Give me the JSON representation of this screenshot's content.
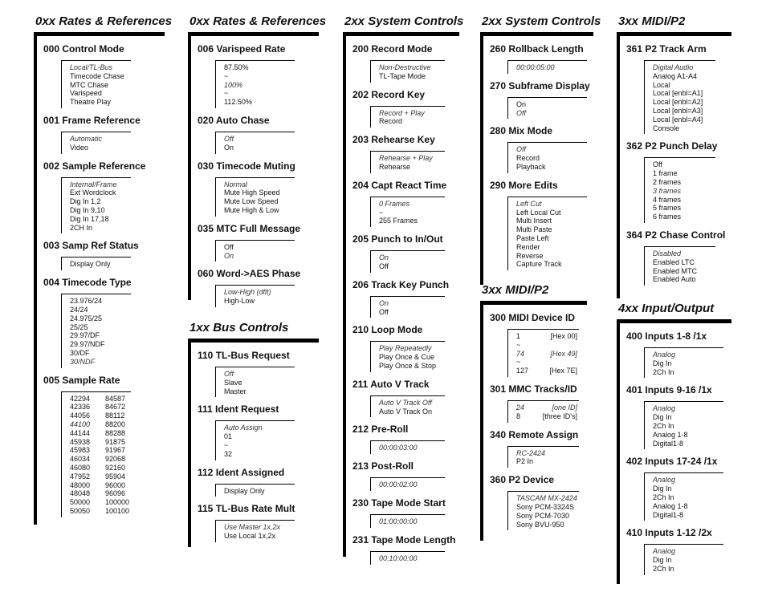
{
  "sections": [
    {
      "heading": "0xx Rates & References",
      "items": [
        {
          "title": "000 Control Mode",
          "options": [
            {
              "text": "Local/TL-Bus",
              "default": true
            },
            {
              "text": "Timecode Chase"
            },
            {
              "text": "MTC Chase"
            },
            {
              "text": "Varispeed"
            },
            {
              "text": "Theatre Play"
            }
          ]
        },
        {
          "title": "001 Frame Reference",
          "options": [
            {
              "text": "Automatic",
              "default": true
            },
            {
              "text": "Video"
            }
          ]
        },
        {
          "title": "002 Sample Reference",
          "options": [
            {
              "text": "Internal/Frame",
              "default": true
            },
            {
              "text": "Ext Wordclock"
            },
            {
              "text": "Dig In 1,2"
            },
            {
              "text": "Dig In 9,10"
            },
            {
              "text": "Dig In 17,18"
            },
            {
              "text": "2CH In"
            }
          ]
        },
        {
          "title": "003 Samp Ref Status",
          "options": [
            {
              "text": "Display Only"
            }
          ]
        },
        {
          "title": "004 Timecode Type",
          "options": [
            {
              "text": "23.976/24"
            },
            {
              "text": "24/24"
            },
            {
              "text": "24.975/25"
            },
            {
              "text": "25/25"
            },
            {
              "text": "29.97/DF"
            },
            {
              "text": "29.97/NDF"
            },
            {
              "text": "30/DF"
            },
            {
              "text": "30/NDF",
              "default": true
            }
          ]
        },
        {
          "title": "005 Sample Rate",
          "options": [
            {
              "text": "42294",
              "text2": "84587"
            },
            {
              "text": "42336",
              "text2": "84672"
            },
            {
              "text": "44056",
              "text2": "88112"
            },
            {
              "text": "44100",
              "text2": "88200",
              "default": true
            },
            {
              "text": "44144",
              "text2": "88288"
            },
            {
              "text": "45938",
              "text2": "91875"
            },
            {
              "text": "45983",
              "text2": "91967"
            },
            {
              "text": "46034",
              "text2": "92068"
            },
            {
              "text": "46080",
              "text2": "92160"
            },
            {
              "text": "47952",
              "text2": "95904"
            },
            {
              "text": "48000",
              "text2": "96000"
            },
            {
              "text": "48048",
              "text2": "96096"
            },
            {
              "text": "50000",
              "text2": "100000"
            },
            {
              "text": "50050",
              "text2": "100100"
            }
          ]
        }
      ]
    },
    {
      "heading": "0xx Rates & References",
      "items": [
        {
          "title": "006 Varispeed Rate",
          "options": [
            {
              "text": "87.50%"
            },
            {
              "text": "~"
            },
            {
              "text": "100%",
              "default": true
            },
            {
              "text": "~"
            },
            {
              "text": "112.50%"
            }
          ]
        },
        {
          "title": "020 Auto Chase",
          "options": [
            {
              "text": "Off",
              "default": true
            },
            {
              "text": "On"
            }
          ]
        },
        {
          "title": "030 Timecode Muting",
          "options": [
            {
              "text": "Normal",
              "default": true
            },
            {
              "text": "Mute High Speed"
            },
            {
              "text": "Mute Low Speed"
            },
            {
              "text": "Mute High & Low"
            }
          ]
        },
        {
          "title": "035 MTC Full Message",
          "options": [
            {
              "text": "Off"
            },
            {
              "text": "On",
              "default": true
            }
          ]
        },
        {
          "title": "060 Word->AES Phase",
          "options": [
            {
              "text": "Low-High (dflt)",
              "default": true
            },
            {
              "text": "High-Low"
            }
          ]
        }
      ]
    },
    {
      "heading": "1xx Bus Controls",
      "items": [
        {
          "title": "110 TL-Bus Request",
          "options": [
            {
              "text": "Off",
              "default": true
            },
            {
              "text": "Slave"
            },
            {
              "text": "Master"
            }
          ]
        },
        {
          "title": "111 Ident Request",
          "options": [
            {
              "text": "Auto Assign",
              "default": true
            },
            {
              "text": "01"
            },
            {
              "text": "~"
            },
            {
              "text": "32"
            }
          ]
        },
        {
          "title": "112 Ident Assigned",
          "options": [
            {
              "text": "Display Only"
            }
          ]
        },
        {
          "title": "115 TL-Bus Rate Mult",
          "options": [
            {
              "text": "Use Master 1x,2x",
              "default": true
            },
            {
              "text": "Use Local 1x,2x"
            }
          ]
        }
      ]
    },
    {
      "heading": "2xx System Controls",
      "items": [
        {
          "title": "200 Record Mode",
          "options": [
            {
              "text": "Non-Destructive",
              "default": true
            },
            {
              "text": "TL-Tape Mode"
            }
          ]
        },
        {
          "title": "202 Record Key",
          "options": [
            {
              "text": "Record + Play",
              "default": true
            },
            {
              "text": "Record"
            }
          ]
        },
        {
          "title": "203 Rehearse Key",
          "options": [
            {
              "text": "Rehearse + Play",
              "default": true
            },
            {
              "text": "Rehearse"
            }
          ]
        },
        {
          "title": "204 Capt React Time",
          "options": [
            {
              "text": "0 Frames",
              "default": true
            },
            {
              "text": "~"
            },
            {
              "text": "255 Frames"
            }
          ]
        },
        {
          "title": "205 Punch to In/Out",
          "options": [
            {
              "text": "On",
              "default": true
            },
            {
              "text": "Off"
            }
          ]
        },
        {
          "title": "206 Track Key Punch",
          "options": [
            {
              "text": "On",
              "default": true
            },
            {
              "text": "Off"
            }
          ]
        },
        {
          "title": "210 Loop Mode",
          "options": [
            {
              "text": "Play Repeatedly",
              "default": true
            },
            {
              "text": "Play Once & Cue"
            },
            {
              "text": "Play Once & Stop"
            }
          ]
        },
        {
          "title": "211 Auto V Track",
          "options": [
            {
              "text": "Auto V Track Off",
              "default": true
            },
            {
              "text": "Auto V Track On"
            }
          ]
        },
        {
          "title": "212 Pre-Roll",
          "options": [
            {
              "text": "00:00:03:00",
              "default": true
            }
          ]
        },
        {
          "title": "213 Post-Roll",
          "options": [
            {
              "text": "00:00:02:00",
              "default": true
            }
          ]
        },
        {
          "title": "230 Tape Mode Start",
          "options": [
            {
              "text": "01:00:00:00",
              "default": true
            }
          ]
        },
        {
          "title": "231 Tape Mode Length",
          "options": [
            {
              "text": "00:10:00:00",
              "default": true
            }
          ]
        }
      ]
    },
    {
      "heading": "2xx System Controls",
      "items": [
        {
          "title": "260 Rollback Length",
          "options": [
            {
              "text": "00:00:05:00",
              "default": true
            }
          ]
        },
        {
          "title": "270 Subframe Display",
          "options": [
            {
              "text": "On"
            },
            {
              "text": "Off",
              "default": true
            }
          ]
        },
        {
          "title": "280 Mix Mode",
          "options": [
            {
              "text": "Off",
              "default": true
            },
            {
              "text": "Record"
            },
            {
              "text": "Playback"
            }
          ]
        },
        {
          "title": "290 More Edits",
          "options": [
            {
              "text": "Left Cut",
              "default": true
            },
            {
              "text": "Left Local Cut"
            },
            {
              "text": "Multi Insert"
            },
            {
              "text": "Multi Paste"
            },
            {
              "text": "Paste Left"
            },
            {
              "text": "Render"
            },
            {
              "text": "Reverse"
            },
            {
              "text": "Capture Track"
            }
          ]
        }
      ]
    },
    {
      "heading": "3xx MIDI/P2",
      "items": [
        {
          "title": "300 MIDI Device ID",
          "options": [
            {
              "text": "1",
              "text2": "[Hex 00]"
            },
            {
              "text": "~"
            },
            {
              "text": "74",
              "text2": "[Hex 49]",
              "default": true,
              "default2": true
            },
            {
              "text": "~"
            },
            {
              "text": "127",
              "text2": "[Hex 7E]"
            }
          ]
        },
        {
          "title": "301 MMC Tracks/ID",
          "options": [
            {
              "text": "24",
              "text2": "[one ID]",
              "default": true,
              "default2": true
            },
            {
              "text": "8",
              "text2": "[three ID's]"
            }
          ]
        },
        {
          "title": "340 Remote Assign",
          "options": [
            {
              "text": "RC-2424",
              "default": true
            },
            {
              "text": "P2 In"
            }
          ]
        },
        {
          "title": "360 P2 Device",
          "options": [
            {
              "text": "TASCAM MX-2424",
              "default": true
            },
            {
              "text": "Sony PCM-3324S"
            },
            {
              "text": "Sony PCM-7030"
            },
            {
              "text": "Sony BVU-950"
            }
          ]
        }
      ]
    },
    {
      "heading": "3xx MIDI/P2",
      "items": [
        {
          "title": "361 P2 Track Arm",
          "options": [
            {
              "text": "Digital Audio",
              "default": true
            },
            {
              "text": "Analog A1-A4"
            },
            {
              "text": "Local"
            },
            {
              "text": "Local [enbl=A1]"
            },
            {
              "text": "Local [enbl=A2]"
            },
            {
              "text": "Local [enbl=A3]"
            },
            {
              "text": "Local [enbl=A4]"
            },
            {
              "text": "Console"
            }
          ]
        },
        {
          "title": "362 P2 Punch Delay",
          "options": [
            {
              "text": "Off"
            },
            {
              "text": "1 frame"
            },
            {
              "text": "2 frames"
            },
            {
              "text": "3 frames",
              "default": true
            },
            {
              "text": "4 frames"
            },
            {
              "text": "5 frames"
            },
            {
              "text": "6 frames"
            }
          ]
        },
        {
          "title": "364 P2 Chase Control",
          "options": [
            {
              "text": "Disabled",
              "default": true
            },
            {
              "text": "Enabled LTC"
            },
            {
              "text": "Enabled MTC"
            },
            {
              "text": "Enabled Auto"
            }
          ]
        }
      ]
    },
    {
      "heading": "4xx Input/Output",
      "items": [
        {
          "title": "400 Inputs 1-8 /1x",
          "options": [
            {
              "text": "Analog",
              "default": true
            },
            {
              "text": "Dig In"
            },
            {
              "text": "2Ch In"
            }
          ]
        },
        {
          "title": "401 Inputs 9-16 /1x",
          "options": [
            {
              "text": "Analog",
              "default": true
            },
            {
              "text": "Dig In"
            },
            {
              "text": "2Ch In"
            },
            {
              "text": "Analog 1-8"
            },
            {
              "text": "Digital1-8"
            }
          ]
        },
        {
          "title": "402 Inputs 17-24 /1x",
          "options": [
            {
              "text": "Analog",
              "default": true
            },
            {
              "text": "Dig In"
            },
            {
              "text": "2Ch In"
            },
            {
              "text": "Analog 1-8"
            },
            {
              "text": "Digital1-8"
            }
          ]
        },
        {
          "title": "410 Inputs 1-12 /2x",
          "options": [
            {
              "text": "Analog",
              "default": true
            },
            {
              "text": "Dig In"
            },
            {
              "text": "2Ch In"
            }
          ]
        }
      ]
    }
  ]
}
